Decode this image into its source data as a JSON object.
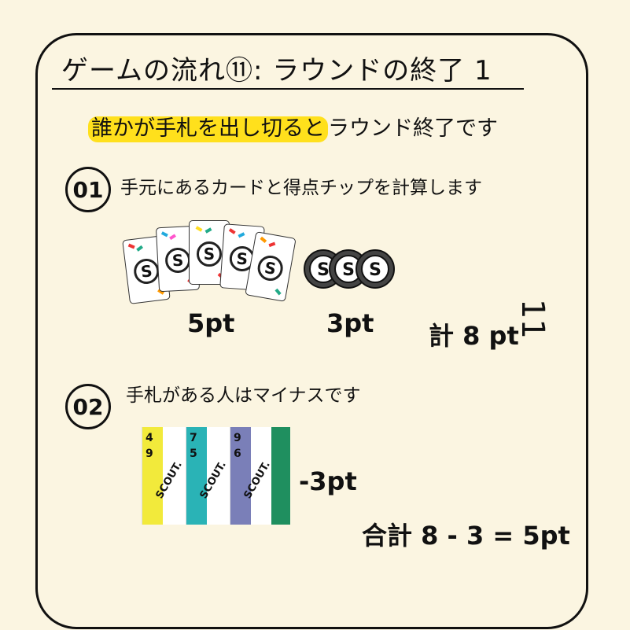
{
  "title": "ゲームの流れ⑪: ラウンドの終了 1",
  "headline": {
    "highlight": "誰かが手札を出し切ると",
    "rest": "ラウンド終了です"
  },
  "steps": [
    {
      "number": "01",
      "text": "手元にあるカードと得点チップを計算します"
    },
    {
      "number": "02",
      "text": "手札がある人はマイナスです"
    }
  ],
  "step1": {
    "cards_points": "5pt",
    "chips_points": "3pt",
    "total": "計 8 pt",
    "card_logo": "S",
    "card_brand": "SCOUT"
  },
  "step2": {
    "minus": "-3pt",
    "total": "合計 8 - 3 = 5pt",
    "hand_cards": [
      {
        "top": "4",
        "bottom": "9",
        "color": "#f2ea3b",
        "logo": "SCOUT."
      },
      {
        "top": "7",
        "bottom": "5",
        "color": "#2ab3b6",
        "logo": "SCOUT."
      },
      {
        "top": "9",
        "bottom": "6",
        "color": "#7a7fb8",
        "logo": "SCOUT."
      }
    ]
  },
  "page_number": "11",
  "colors": {
    "background": "#fbf5e1",
    "highlight": "#ffe01c"
  }
}
